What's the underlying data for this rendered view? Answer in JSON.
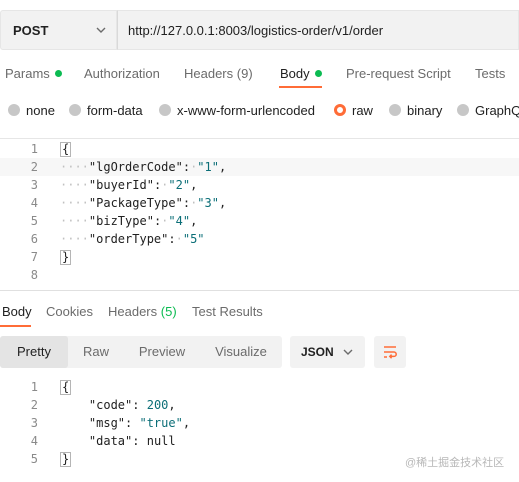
{
  "request": {
    "method": "POST",
    "url": "http://127.0.0.1:8003/logistics-order/v1/order"
  },
  "request_tabs": {
    "params": "Params",
    "authorization": "Authorization",
    "headers": "Headers",
    "headers_count": "(9)",
    "body": "Body",
    "pre_request": "Pre-request Script",
    "tests": "Tests"
  },
  "body_types": {
    "none": "none",
    "form_data": "form-data",
    "urlencoded": "x-www-form-urlencoded",
    "raw": "raw",
    "binary": "binary",
    "graphql": "GraphQL",
    "selected": "raw"
  },
  "request_body": {
    "line_numbers": [
      "1",
      "2",
      "3",
      "4",
      "5",
      "6",
      "7",
      "8"
    ],
    "open_brace": "{",
    "close_brace": "}",
    "fields": [
      {
        "key": "\"lgOrderCode\"",
        "value": "\"1\"",
        "sep": ","
      },
      {
        "key": "\"buyerId\"",
        "value": "\"2\"",
        "sep": ","
      },
      {
        "key": "\"PackageType\"",
        "value": "\"3\"",
        "sep": ","
      },
      {
        "key": "\"bizType\"",
        "value": "\"4\"",
        "sep": ","
      },
      {
        "key": "\"orderType\"",
        "value": "\"5\"",
        "sep": ""
      }
    ]
  },
  "response_tabs": {
    "body": "Body",
    "cookies": "Cookies",
    "headers": "Headers",
    "headers_count": "(5)",
    "test_results": "Test Results"
  },
  "response_toolbar": {
    "pretty": "Pretty",
    "raw": "Raw",
    "preview": "Preview",
    "visualize": "Visualize",
    "format": "JSON"
  },
  "response_body": {
    "line_numbers": [
      "1",
      "2",
      "3",
      "4",
      "5"
    ],
    "open_brace": "{",
    "close_brace": "}",
    "fields": [
      {
        "key": "\"code\"",
        "value": "200",
        "sep": ","
      },
      {
        "key": "\"msg\"",
        "value": "\"true\"",
        "sep": ","
      },
      {
        "key": "\"data\"",
        "value": "null",
        "sep": ""
      }
    ]
  },
  "watermark": "@稀土掘金技术社区",
  "colors": {
    "accent": "#ff6c37",
    "status_green": "#0cbb52",
    "value_teal": "#0b6e77"
  }
}
